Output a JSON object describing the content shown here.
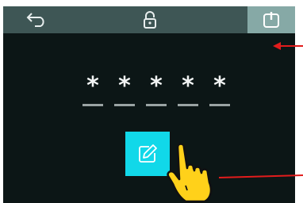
{
  "topbar": {
    "icons": [
      "back-arrow-icon",
      "padlock-icon",
      "power-icon"
    ]
  },
  "pin": {
    "chars": [
      "*",
      "*",
      "*",
      "*",
      "*"
    ]
  },
  "edit_button": {
    "icon": "edit-pencil-icon"
  },
  "colors": {
    "screen_bg": "#0c1616",
    "topbar_bg": "#3e5655",
    "power_button_bg": "#86a9a6",
    "accent_cyan": "#11d8e9",
    "annotation_red": "#e21c1c",
    "hand_yellow": "#ffd11a"
  }
}
